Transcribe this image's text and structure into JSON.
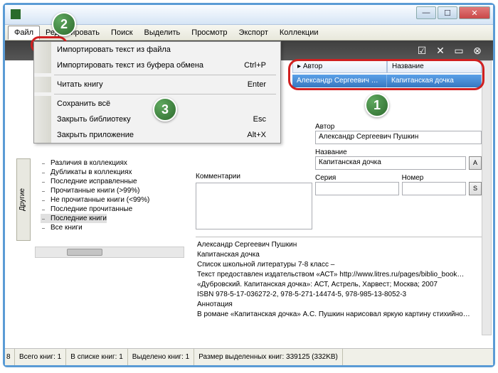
{
  "menubar": [
    "Файл",
    "Редактировать",
    "Поиск",
    "Выделить",
    "Просмотр",
    "Экспорт",
    "Коллекции"
  ],
  "dropdown": {
    "import_file": "Импортировать текст из файла",
    "import_clipboard": "Импортировать текст из буфера обмена",
    "import_clipboard_key": "Ctrl+P",
    "read_book": "Читать книгу",
    "read_book_key": "Enter",
    "save_all": "Сохранить всё",
    "close_library": "Закрыть библиотеку",
    "close_library_key": "Esc",
    "close_app": "Закрыть приложение",
    "close_app_key": "Alt+X"
  },
  "columns": {
    "author": "Автор",
    "title": "Название"
  },
  "row": {
    "author": "Александр Сергеевич Пу…",
    "title": "Капитанская дочка"
  },
  "tree": [
    "Различия в коллекциях",
    "Дубликаты в коллекциях",
    "Последние исправленные",
    "Прочитанные книги (>99%)",
    "Не прочитанные книги (<99%)",
    "Последние прочитанные",
    "Последние книги",
    "Все книги"
  ],
  "side_tab": "Другие",
  "form": {
    "author_label": "Автор",
    "author_value": "Александр Сергеевич Пушкин",
    "title_label": "Название",
    "title_value": "Капитанская дочка",
    "series_label": "Серия",
    "series_value": "",
    "number_label": "Номер",
    "number_value": "",
    "btn_a": "A",
    "btn_s": "S"
  },
  "comments_label": "Комментарии",
  "details": [
    "Александр Сергеевич Пушкин",
    "Капитанская дочка",
    "Список школьной литературы 7-8 класс –",
    "Текст предоставлен издательством «АСТ» http://www.litres.ru/pages/biblio_book…",
    "«Дубровский. Капитанская дочка»: АСТ, Астрель, Харвест; Москва; 2007",
    "ISBN 978-5-17-036272-2, 978-5-271-14474-5, 978-985-13-8052-3",
    "Аннотация",
    "В романе «Капитанская дочка» А.С. Пушкин нарисовал яркую картину стихийно…"
  ],
  "status": {
    "total": "Всего книг: 1",
    "inlist": "В списке книг: 1",
    "selected": "Выделено книг: 1",
    "size": "Размер выделенных книг: 339125  (332KB)",
    "lead": "8"
  },
  "badges": {
    "b1": "1",
    "b2": "2",
    "b3": "3"
  }
}
